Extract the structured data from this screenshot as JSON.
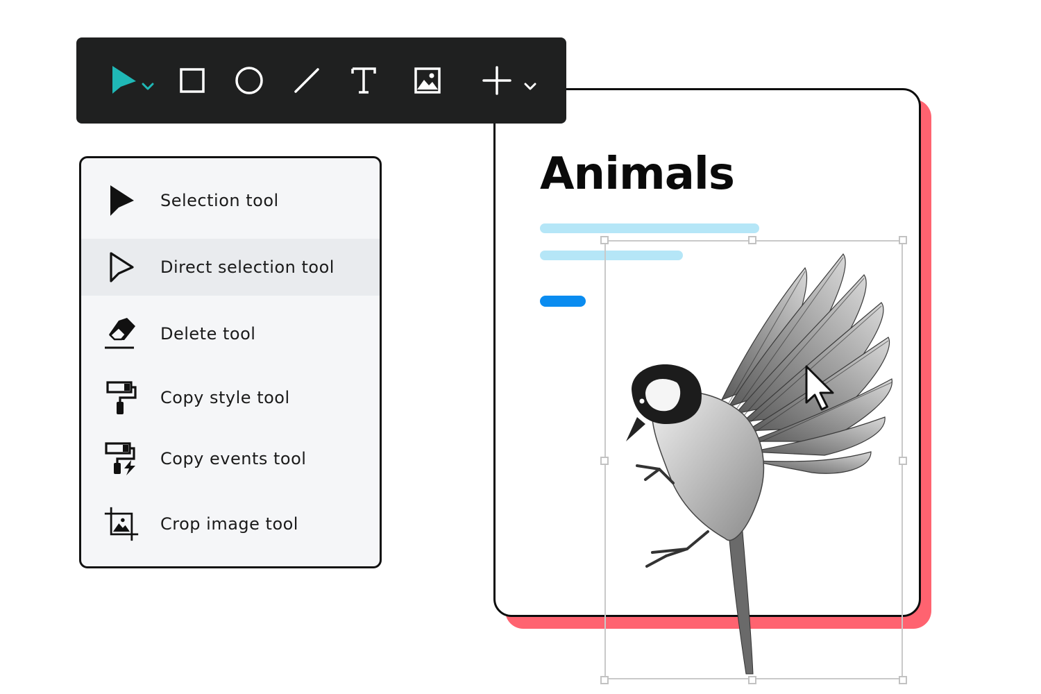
{
  "toolbar": {
    "tools": [
      {
        "name": "selection-tool-icon",
        "color": "#1fb8b6"
      },
      {
        "name": "rectangle-icon"
      },
      {
        "name": "ellipse-icon"
      },
      {
        "name": "line-icon"
      },
      {
        "name": "text-icon"
      },
      {
        "name": "image-icon"
      },
      {
        "name": "plus-icon"
      }
    ],
    "accent": "#1fb8b6",
    "background": "#1f2020"
  },
  "menu": {
    "items": [
      {
        "icon": "selection-arrow-icon",
        "label": "Selection tool"
      },
      {
        "icon": "direct-selection-arrow-icon",
        "label": "Direct selection tool",
        "active": true
      },
      {
        "icon": "eraser-icon",
        "label": "Delete tool"
      },
      {
        "icon": "paint-roller-icon",
        "label": "Copy style tool"
      },
      {
        "icon": "paint-roller-bolt-icon",
        "label": "Copy events tool"
      },
      {
        "icon": "crop-image-icon",
        "label": "Crop image tool"
      }
    ]
  },
  "card": {
    "title": "Animals",
    "shadow_color": "#ff6370",
    "line_color": "#b5e6f7",
    "button_color": "#0a8cf0"
  },
  "canvas": {
    "image": "bird-image",
    "cursor": "pointer-cursor-icon"
  }
}
